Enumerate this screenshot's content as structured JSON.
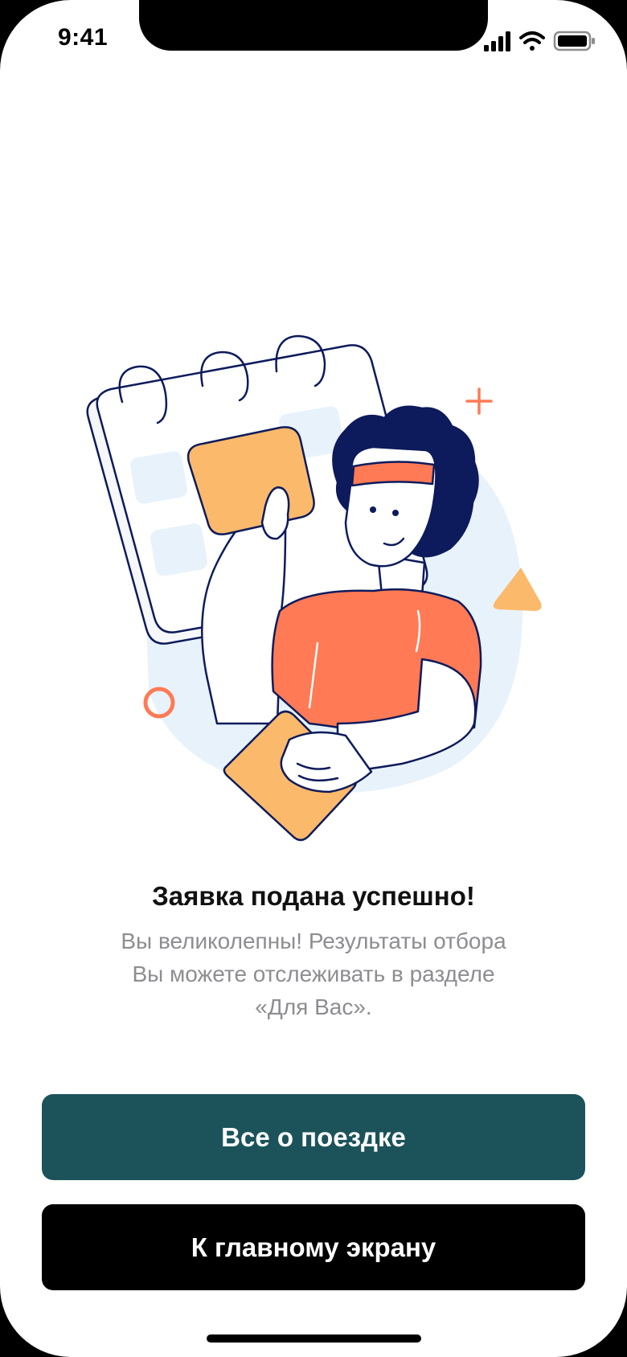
{
  "status_bar": {
    "time": "9:41",
    "icons": [
      "signal-icon",
      "wifi-icon",
      "battery-icon"
    ]
  },
  "illustration": {
    "name": "success-calendar-illustration",
    "colors": {
      "navy": "#0d1b5c",
      "orange": "#ff7a55",
      "yellow": "#fbb96b",
      "light_blue": "#e8f2fb"
    }
  },
  "message": {
    "title": "Заявка подана успешно!",
    "text_line1": "Вы великолепны! Результаты отбора",
    "text_line2": "Вы можете отслеживать в разделе",
    "text_line3": "«Для Вас»."
  },
  "actions": {
    "trip_label": "Все о поездке",
    "home_label": "К главному экрану"
  },
  "colors": {
    "primary_button": "#1c535b",
    "secondary_button": "#000000",
    "subtitle_text": "#8d8d92"
  }
}
